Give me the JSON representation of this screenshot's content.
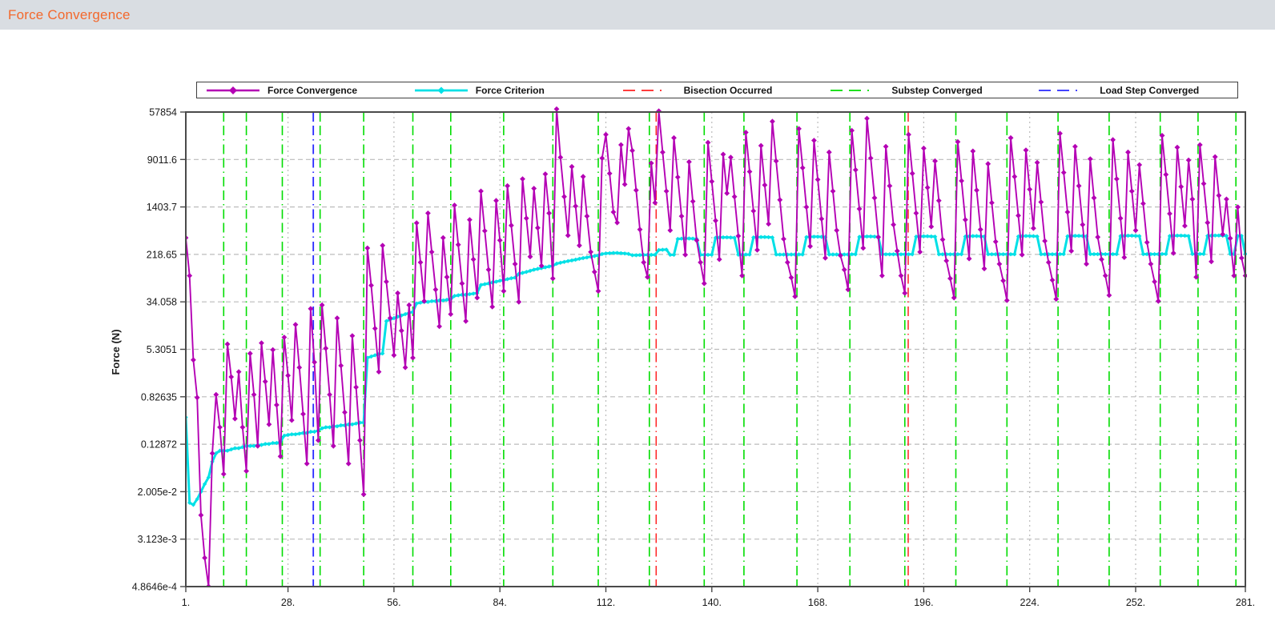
{
  "header": {
    "title": "Force Convergence"
  },
  "legend": {
    "items": [
      {
        "id": "force_convergence",
        "label": "Force Convergence"
      },
      {
        "id": "force_criterion",
        "label": "Force Criterion"
      },
      {
        "id": "bisection_occurred",
        "label": "Bisection Occurred"
      },
      {
        "id": "substep_converged",
        "label": "Substep Converged"
      },
      {
        "id": "load_step_converged",
        "label": "Load Step Converged"
      }
    ]
  },
  "chart_data": {
    "type": "line",
    "title": "Force Convergence",
    "xlabel": "",
    "ylabel": "Force (N)",
    "x_axis": {
      "min": 1,
      "max": 281,
      "tick_values": [
        1,
        28,
        56,
        84,
        112,
        140,
        168,
        196,
        224,
        252,
        281
      ],
      "tick_labels": [
        "1.",
        "28.",
        "56.",
        "84.",
        "112.",
        "140.",
        "168.",
        "196.",
        "224.",
        "252.",
        "281."
      ]
    },
    "y_axis": {
      "scale": "log",
      "min": 0.00048646,
      "max": 57854,
      "tick_values": [
        57854,
        9011.6,
        1403.7,
        218.65,
        34.058,
        5.3051,
        0.82635,
        0.12872,
        0.02005,
        0.003123,
        0.00048646
      ],
      "tick_labels": [
        "57854",
        "9011.6",
        "1403.7",
        "218.65",
        "34.058",
        "5.3051",
        "0.82635",
        "0.12872",
        "2.005e-2",
        "3.123e-3",
        "4.8646e-4"
      ]
    },
    "colors": {
      "force_convergence": "#b400b4",
      "force_criterion": "#00e0e6",
      "bisection_occurred": "#ff2222",
      "substep_converged": "#00dd00",
      "load_step_converged": "#2929ff",
      "grid": "#bbbbbb",
      "axis": "#4a4a4a",
      "text": "#1a1a1a"
    },
    "series": [
      {
        "name": "Force Convergence",
        "color_key": "force_convergence",
        "marker": "diamond",
        "x_start": 1,
        "values": [
          420,
          95,
          3.5,
          0.8,
          0.008,
          0.0015,
          0.00049,
          0.09,
          0.9,
          0.25,
          0.04,
          6.5,
          1.8,
          0.35,
          2.2,
          0.25,
          0.045,
          4.5,
          0.9,
          0.12,
          6.8,
          1.5,
          0.28,
          5.2,
          0.6,
          0.08,
          8.5,
          1.9,
          0.33,
          14,
          2.6,
          0.42,
          0.06,
          26,
          3.2,
          0.15,
          30,
          5.5,
          0.9,
          0.12,
          18,
          2.8,
          0.45,
          0.06,
          9,
          1.2,
          0.15,
          0.018,
          280,
          65,
          12,
          2.2,
          310,
          75,
          18,
          4.2,
          48,
          11,
          2.6,
          30,
          3.8,
          750,
          160,
          35,
          1100,
          240,
          55,
          13,
          420,
          90,
          21,
          1500,
          320,
          70,
          16,
          850,
          180,
          40,
          2600,
          550,
          120,
          28,
          1800,
          380,
          52,
          3200,
          680,
          150,
          34,
          4200,
          900,
          200,
          2900,
          620,
          140,
          5100,
          1100,
          85,
          65000,
          9800,
          2100,
          460,
          6800,
          1450,
          310,
          4600,
          980,
          240,
          110,
          52,
          9500,
          24000,
          5200,
          1150,
          760,
          16000,
          3400,
          30000,
          12800,
          2700,
          580,
          160,
          90,
          7800,
          1650,
          60000,
          12000,
          2600,
          560,
          21000,
          4500,
          980,
          215,
          8200,
          1750,
          380,
          160,
          70,
          17500,
          3800,
          820,
          180,
          11000,
          2400,
          9800,
          2100,
          450,
          95,
          26000,
          5600,
          1200,
          260,
          15500,
          3300,
          720,
          40000,
          8500,
          1850,
          400,
          160,
          88,
          42,
          30000,
          6500,
          1400,
          300,
          19000,
          4100,
          880,
          190,
          12000,
          2600,
          560,
          210,
          120,
          55,
          28000,
          6000,
          1300,
          280,
          45000,
          9500,
          2000,
          430,
          95,
          15000,
          3200,
          700,
          250,
          95,
          48,
          24000,
          5200,
          1100,
          240,
          14000,
          3000,
          650,
          8500,
          1800,
          390,
          170,
          85,
          40,
          18000,
          3900,
          850,
          185,
          12500,
          2700,
          580,
          125,
          7600,
          1650,
          360,
          150,
          78,
          36,
          21000,
          4600,
          1000,
          215,
          13000,
          2800,
          610,
          8000,
          1700,
          370,
          160,
          80,
          38,
          25000,
          5400,
          1150,
          250,
          15000,
          3200,
          700,
          150,
          9200,
          2000,
          430,
          180,
          95,
          44,
          19500,
          4200,
          900,
          195,
          12000,
          2600,
          560,
          7300,
          1600,
          350,
          150,
          75,
          35,
          23000,
          5000,
          1080,
          230,
          14500,
          3100,
          670,
          8800,
          1900,
          90,
          16000,
          3500,
          760,
          165,
          10000,
          2200,
          480,
          1900,
          410,
          95,
          1400,
          190,
          95
        ]
      },
      {
        "name": "Force Criterion",
        "color_key": "force_criterion",
        "marker": "diamond",
        "x_start": 1,
        "values": [
          0.37,
          0.013,
          0.012,
          0.015,
          0.02,
          0.027,
          0.035,
          0.065,
          0.09,
          0.1,
          0.1,
          0.1,
          0.105,
          0.11,
          0.11,
          0.115,
          0.12,
          0.12,
          0.12,
          0.125,
          0.125,
          0.13,
          0.13,
          0.135,
          0.135,
          0.14,
          0.18,
          0.185,
          0.19,
          0.19,
          0.195,
          0.2,
          0.2,
          0.21,
          0.21,
          0.22,
          0.24,
          0.25,
          0.25,
          0.26,
          0.26,
          0.27,
          0.27,
          0.28,
          0.28,
          0.29,
          0.3,
          0.3,
          3.8,
          4.0,
          4.2,
          4.4,
          4.5,
          16,
          17,
          18,
          19,
          20,
          21,
          22,
          23,
          32,
          33,
          34,
          34,
          35,
          35,
          36,
          36,
          37,
          38,
          43,
          44,
          45,
          45,
          46,
          47,
          48,
          66,
          68,
          70,
          73,
          75,
          78,
          80,
          83,
          86,
          88,
          102,
          106,
          110,
          115,
          120,
          124,
          128,
          132,
          136,
          140,
          152,
          158,
          163,
          168,
          173,
          178,
          184,
          189,
          194,
          200,
          205,
          210,
          222,
          226,
          229,
          231,
          231,
          229,
          226,
          223,
          212,
          212,
          213,
          214,
          215,
          215,
          215,
          260,
          262,
          264,
          215,
          215,
          400,
          405,
          408,
          408,
          405,
          400,
          215,
          215,
          215,
          216,
          420,
          424,
          427,
          427,
          424,
          420,
          216,
          216,
          217,
          217,
          425,
          429,
          432,
          432,
          429,
          425,
          217,
          217,
          217,
          217,
          218,
          218,
          218,
          218,
          430,
          434,
          437,
          437,
          434,
          430,
          218,
          218,
          218,
          218,
          218,
          218,
          219,
          219,
          435,
          439,
          442,
          442,
          439,
          435,
          219,
          219,
          219,
          219,
          219,
          219,
          219,
          219,
          219,
          438,
          442,
          445,
          445,
          442,
          438,
          219,
          219,
          219,
          219,
          219,
          220,
          220,
          440,
          444,
          448,
          448,
          444,
          440,
          220,
          220,
          220,
          220,
          220,
          220,
          220,
          220,
          443,
          447,
          450,
          450,
          447,
          443,
          220,
          220,
          220,
          220,
          220,
          221,
          221,
          446,
          450,
          453,
          453,
          450,
          446,
          221,
          221,
          221,
          221,
          221,
          221,
          221,
          221,
          448,
          452,
          455,
          455,
          452,
          448,
          221,
          221,
          221,
          221,
          221,
          222,
          222,
          450,
          454,
          457,
          457,
          454,
          450,
          222,
          222,
          222,
          222,
          452,
          456,
          458,
          458,
          456,
          452,
          222,
          222,
          450,
          452,
          222
        ]
      }
    ],
    "event_lines": {
      "substep_converged": {
        "color_key": "substep_converged",
        "x": [
          11,
          17,
          26.5,
          36.5,
          48,
          61,
          71,
          85,
          98,
          110,
          123.5,
          138,
          148.5,
          162.5,
          176.5,
          191,
          204.5,
          218,
          231.5,
          245,
          258.5,
          268.5,
          278.5
        ]
      },
      "bisection_occurred": {
        "color_key": "bisection_occurred",
        "x": [
          125.3,
          191.9
        ]
      },
      "load_step_converged": {
        "color_key": "load_step_converged",
        "x": [
          34.7
        ]
      }
    },
    "grid": {
      "horizontal": true,
      "vertical": true
    },
    "legend_position": "top"
  }
}
